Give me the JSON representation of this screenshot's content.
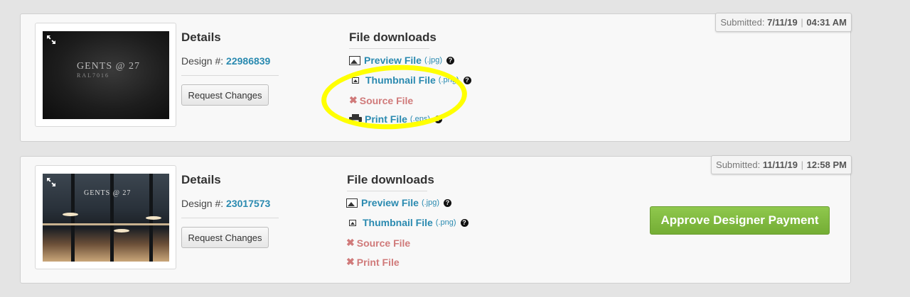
{
  "orders": [
    {
      "submitted_label": "Submitted:",
      "submitted_date": "7/11/19",
      "submitted_sep": "|",
      "submitted_time": "04:31 AM",
      "thumb_brand": "GENTS @ 27",
      "thumb_sub": "RAL7016",
      "details_title": "Details",
      "design_label": "Design #:",
      "design_number": "22986839",
      "request_changes": "Request Changes",
      "file_downloads_title": "File downloads",
      "files": {
        "preview": {
          "label": "Preview File",
          "ext": "(.jpg)"
        },
        "thumbnail": {
          "label": "Thumbnail File",
          "ext": "(.png)"
        },
        "source": {
          "label": "Source File"
        },
        "print": {
          "label": "Print File",
          "ext": "(.eps)"
        }
      }
    },
    {
      "submitted_label": "Submitted:",
      "submitted_date": "11/11/19",
      "submitted_sep": "|",
      "submitted_time": "12:58 PM",
      "thumb_brand": "GENTS @ 27",
      "details_title": "Details",
      "design_label": "Design #:",
      "design_number": "23017573",
      "request_changes": "Request Changes",
      "file_downloads_title": "File downloads",
      "files": {
        "preview": {
          "label": "Preview File",
          "ext": "(.jpg)"
        },
        "thumbnail": {
          "label": "Thumbnail File",
          "ext": "(.png)"
        },
        "source": {
          "label": "Source File"
        },
        "print": {
          "label": "Print File"
        }
      },
      "approve_label": "Approve Designer Payment"
    }
  ],
  "colors": {
    "link": "#2a8ab0",
    "missing": "#d07a7a",
    "approve": "#7fba3f",
    "highlight": "#ffff00"
  }
}
